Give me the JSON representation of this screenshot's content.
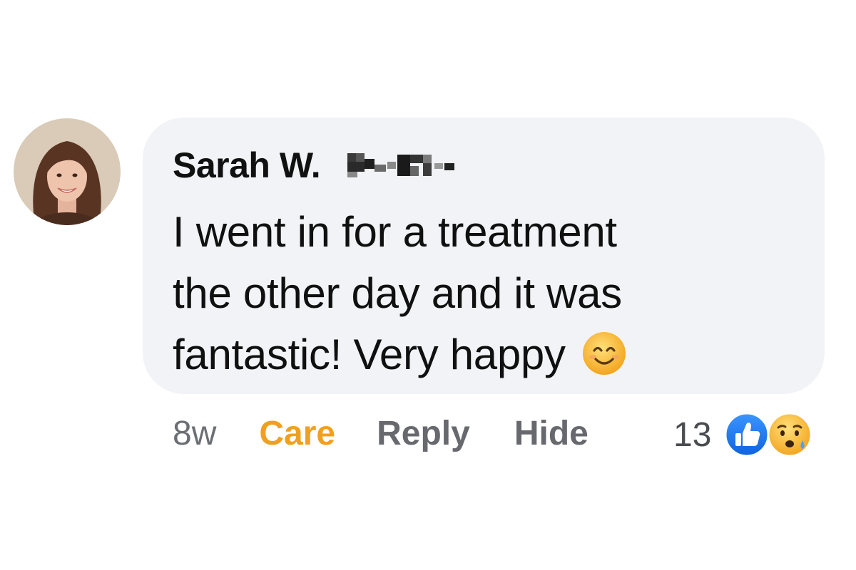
{
  "comment": {
    "author": "Sarah W.",
    "text_lines": [
      "I went in for a treatment",
      "the other day and it was",
      "fantastic! Very happy"
    ],
    "emoji": "smiling-face-with-smiling-eyes"
  },
  "actions": {
    "time": "8w",
    "reaction_label": "Care",
    "reply_label": "Reply",
    "hide_label": "Hide"
  },
  "reactions": {
    "count": "13",
    "icons": [
      "like-icon",
      "sad-face-icon"
    ]
  },
  "colors": {
    "bubble": "#f2f3f6",
    "care": "#f0a020",
    "like_blue": "#1877f2",
    "emoji_yellow": "#f7c04a"
  }
}
